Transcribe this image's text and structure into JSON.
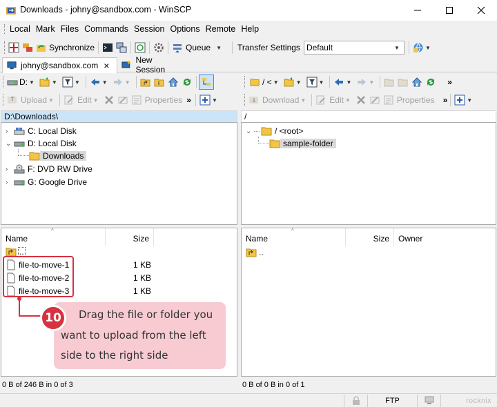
{
  "window": {
    "title": "Downloads - johny@sandbox.com - WinSCP"
  },
  "menu": [
    "Local",
    "Mark",
    "Files",
    "Commands",
    "Session",
    "Options",
    "Remote",
    "Help"
  ],
  "toolbar": {
    "synchronize_label": "Synchronize",
    "queue_label": "Queue",
    "transfer_settings_label": "Transfer Settings",
    "transfer_preset": "Default"
  },
  "tabs": [
    {
      "label": "johny@sandbox.com",
      "close": "×"
    },
    {
      "label": "New Session"
    }
  ],
  "left_pane": {
    "drive": "D:",
    "actions": {
      "upload": "Upload",
      "edit": "Edit",
      "properties": "Properties"
    },
    "path": "D:\\Downloads\\",
    "tree": [
      {
        "label": "C: Local Disk"
      },
      {
        "label": "D: Local Disk"
      },
      {
        "label": "Downloads"
      },
      {
        "label": "F: DVD RW Drive"
      },
      {
        "label": "G: Google Drive"
      }
    ],
    "columns": {
      "name": "Name",
      "size": "Size"
    },
    "parent_dir": "..",
    "files": [
      {
        "name": "file-to-move-1",
        "size": "1 KB"
      },
      {
        "name": "file-to-move-2",
        "size": "1 KB"
      },
      {
        "name": "file-to-move-3",
        "size": "1 KB"
      }
    ],
    "status": "0 B of 246 B in 0 of 3"
  },
  "right_pane": {
    "path_combo": "/ <",
    "actions": {
      "download": "Download",
      "edit": "Edit",
      "properties": "Properties"
    },
    "path": "/",
    "tree": [
      {
        "label": "/ <root>"
      },
      {
        "label": "sample-folder"
      }
    ],
    "columns": {
      "name": "Name",
      "size": "Size",
      "owner": "Owner"
    },
    "parent_dir": "..",
    "status": "0 B of 0 B in 0 of 1"
  },
  "statusbar": {
    "protocol": "FTP",
    "watermark": "rocknix"
  },
  "annotation": {
    "step": "10",
    "lines": [
      "Drag the file or folder you",
      "want to upload from the left",
      "side to the right side"
    ]
  },
  "colors": {
    "accent": "#d6323f",
    "callout_bg": "#f8cbd3",
    "path_active": "#cce4f7"
  }
}
